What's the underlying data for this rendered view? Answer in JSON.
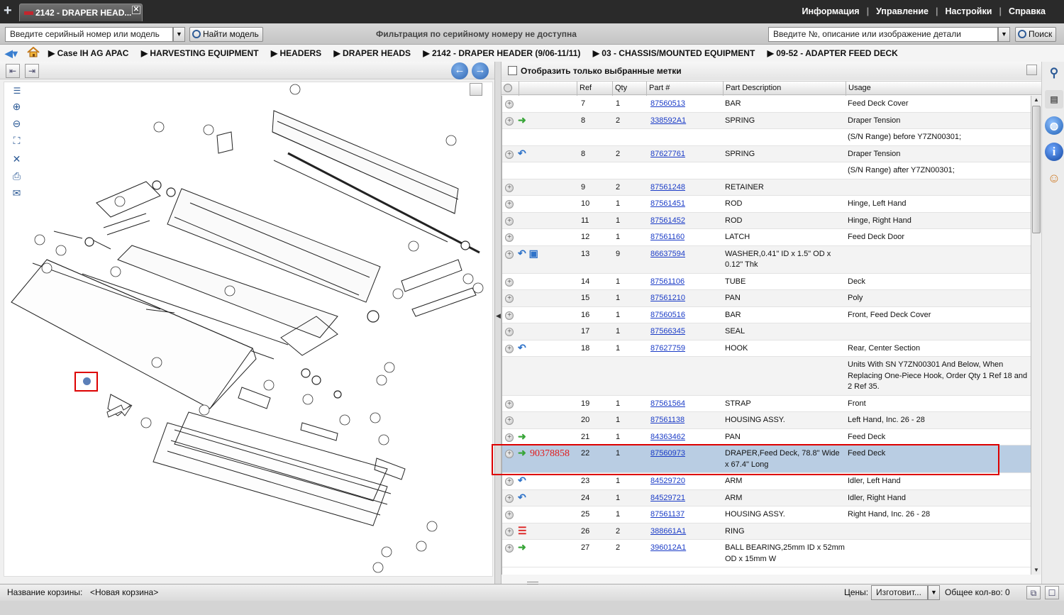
{
  "tab": {
    "title": "2142 - DRAPER HEAD..."
  },
  "topnav": [
    "Информация",
    "Управление",
    "Настройки",
    "Справка"
  ],
  "toolbar": {
    "serial_placeholder": "Введите серийный номер или модель",
    "find_model": "Найти модель",
    "filter_status": "Фильтрация по серийному номеру не доступна",
    "part_search_placeholder": "Введите №, описание или изображение детали",
    "search": "Поиск"
  },
  "breadcrumb": [
    "Case IH AG APAC",
    "HARVESTING EQUIPMENT",
    "HEADERS",
    "DRAPER HEADS",
    "2142 - DRAPER HEADER (9/06-11/11)",
    "03 - CHASSIS/MOUNTED EQUIPMENT",
    "09-52 - ADAPTER FEED DECK"
  ],
  "parts_panel": {
    "show_selected_label": "Отобразить только выбранные метки",
    "columns": [
      "Ref",
      "Qty",
      "Part #",
      "Part Description",
      "Usage"
    ],
    "rows": [
      {
        "ref": "7",
        "qty": "1",
        "part": "87560513",
        "desc": "BAR",
        "usage": "Feed Deck Cover",
        "icon": ""
      },
      {
        "ref": "8",
        "qty": "2",
        "part": "338592A1",
        "desc": "SPRING",
        "usage": "Draper Tension",
        "icon": "green-arrow"
      },
      {
        "ref": "",
        "qty": "",
        "part": "",
        "desc": "",
        "usage": "(S/N Range) before Y7ZN00301;",
        "icon": "",
        "cont": true
      },
      {
        "ref": "8",
        "qty": "2",
        "part": "87627761",
        "desc": "SPRING",
        "usage": "Draper Tension",
        "icon": "blue-arrow"
      },
      {
        "ref": "",
        "qty": "",
        "part": "",
        "desc": "",
        "usage": "(S/N Range) after Y7ZN00301;",
        "icon": "",
        "cont": true
      },
      {
        "ref": "9",
        "qty": "2",
        "part": "87561248",
        "desc": "RETAINER",
        "usage": "",
        "icon": ""
      },
      {
        "ref": "10",
        "qty": "1",
        "part": "87561451",
        "desc": "ROD",
        "usage": "Hinge, Left Hand",
        "icon": ""
      },
      {
        "ref": "11",
        "qty": "1",
        "part": "87561452",
        "desc": "ROD",
        "usage": "Hinge, Right Hand",
        "icon": ""
      },
      {
        "ref": "12",
        "qty": "1",
        "part": "87561160",
        "desc": "LATCH",
        "usage": "Feed Deck Door",
        "icon": ""
      },
      {
        "ref": "13",
        "qty": "9",
        "part": "86637594",
        "desc": "WASHER,0.41\" ID x 1.5\" OD x 0.12\" Thk",
        "usage": "",
        "icon": "blue-arrow-box"
      },
      {
        "ref": "14",
        "qty": "1",
        "part": "87561106",
        "desc": "TUBE",
        "usage": "Deck",
        "icon": ""
      },
      {
        "ref": "15",
        "qty": "1",
        "part": "87561210",
        "desc": "PAN",
        "usage": "Poly",
        "icon": ""
      },
      {
        "ref": "16",
        "qty": "1",
        "part": "87560516",
        "desc": "BAR",
        "usage": "Front, Feed Deck Cover",
        "icon": ""
      },
      {
        "ref": "17",
        "qty": "1",
        "part": "87566345",
        "desc": "SEAL",
        "usage": "",
        "icon": ""
      },
      {
        "ref": "18",
        "qty": "1",
        "part": "87627759",
        "desc": "HOOK",
        "usage": "Rear, Center Section",
        "icon": "blue-arrow"
      },
      {
        "ref": "",
        "qty": "",
        "part": "",
        "desc": "",
        "usage": "Units With SN Y7ZN00301 And Below, When Replacing One-Piece Hook, Order Qty 1 Ref 18 and 2 Ref 35.",
        "icon": "",
        "cont": true
      },
      {
        "ref": "19",
        "qty": "1",
        "part": "87561564",
        "desc": "STRAP",
        "usage": "Front",
        "icon": ""
      },
      {
        "ref": "20",
        "qty": "1",
        "part": "87561138",
        "desc": "HOUSING ASSY.",
        "usage": "Left Hand, Inc. 26 - 28",
        "icon": ""
      },
      {
        "ref": "21",
        "qty": "1",
        "part": "84363462",
        "desc": "PAN",
        "usage": "Feed Deck",
        "icon": "green-arrow"
      },
      {
        "ref": "22",
        "qty": "1",
        "part": "87560973",
        "desc": "DRAPER,Feed Deck, 78.8\" Wide x 67.4\" Long",
        "usage": "Feed Deck",
        "icon": "green-arrow",
        "selected": true
      },
      {
        "ref": "23",
        "qty": "1",
        "part": "84529720",
        "desc": "ARM",
        "usage": "Idler, Left Hand",
        "icon": "blue-arrow"
      },
      {
        "ref": "24",
        "qty": "1",
        "part": "84529721",
        "desc": "ARM",
        "usage": "Idler, Right Hand",
        "icon": "blue-arrow"
      },
      {
        "ref": "25",
        "qty": "1",
        "part": "87561137",
        "desc": "HOUSING ASSY.",
        "usage": "Right Hand, Inc. 26 - 28",
        "icon": ""
      },
      {
        "ref": "26",
        "qty": "2",
        "part": "388661A1",
        "desc": "RING",
        "usage": "",
        "icon": "red-list"
      },
      {
        "ref": "27",
        "qty": "2",
        "part": "396012A1",
        "desc": "BALL BEARING,25mm ID x 52mm OD x 15mm W",
        "usage": "",
        "icon": "green-arrow"
      }
    ],
    "annotation": "90378858"
  },
  "status": {
    "cart_label": "Название корзины:",
    "cart_value": "<Новая корзина>",
    "price_label": "Цены:",
    "price_value": "Изготовит...",
    "total_label": "Общее кол-во: 0"
  }
}
